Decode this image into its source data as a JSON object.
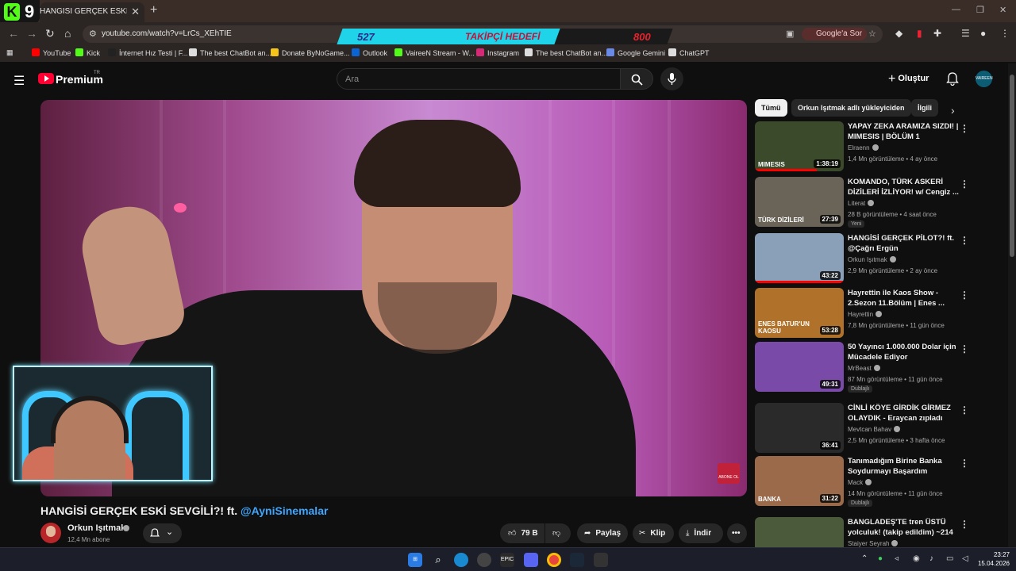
{
  "browser": {
    "tab_title": "HANGİSİ GERÇEK ESKİ SEVGİLİ?! ft.",
    "url": "youtube.com/watch?v=LrCs_XEhTIE",
    "google_sor": "Google'a Sor",
    "bookmarks": [
      "YouTube",
      "Kick",
      "İnternet Hız Testi | F...",
      "The best ChatBot an...",
      "Donate ByNoGame...",
      "Outlook",
      "VaireeN Stream - W...",
      "Instagram",
      "The best ChatBot an...",
      "Google Gemini",
      "ChatGPT"
    ]
  },
  "stream_overlay": {
    "logo_k": "K",
    "logo_9": "9",
    "current": "527",
    "title": "TAKİPÇİ HEDEFİ",
    "goal": "800"
  },
  "youtube": {
    "brand": "Premium",
    "region": "TR",
    "search_placeholder": "Ara",
    "create_label": "Oluştur",
    "avatar_text": "VAIREEN"
  },
  "video": {
    "title_main": "HANGİSİ GERÇEK ESKİ SEVGİLİ?! ft. ",
    "title_link": "@AyniSinemalar",
    "channel": "Orkun Işıtmak",
    "subscribers": "12,4 Mn abone",
    "likes": "79 B",
    "share": "Paylaş",
    "clip": "Klip",
    "download": "İndir",
    "watermark": "ABONE OL"
  },
  "sidebar": {
    "chips": [
      "Tümü",
      "Orkun Işıtmak adlı yükleyiciden",
      "İlgili"
    ],
    "recommendations": [
      {
        "title": "YAPAY ZEKA ARAMIZA SIZDI! | MIMESIS | BÖLÜM 1",
        "channel": "Elraenn",
        "views": "1,4 Mn görüntüleme",
        "age": "4 ay önce",
        "duration": "1:38:19",
        "badge": "",
        "thumb_text": "MIMESIS",
        "progress": 0.7,
        "color": "#3a4a2a"
      },
      {
        "title": "KOMANDO, TÜRK ASKERİ DİZİLERİ İZLİYOR! w/ Cengiz ...",
        "channel": "Literat",
        "views": "28 B görüntüleme",
        "age": "4 saat önce",
        "duration": "27:39",
        "badge": "Yeni",
        "thumb_text": "TÜRK DİZİLERİ",
        "progress": 0,
        "color": "#6a6458"
      },
      {
        "title": "HANGİSİ GERÇEK PİLOT?! ft. @Çağrı Ergün",
        "channel": "Orkun Işıtmak",
        "views": "2,9 Mn görüntüleme",
        "age": "2 ay önce",
        "duration": "43:22",
        "badge": "",
        "thumb_text": "",
        "progress": 1.0,
        "color": "#8aa0b8"
      },
      {
        "title": "Hayrettin ile Kaos Show - 2.Sezon 11.Bölüm | Enes ...",
        "channel": "Hayrettin",
        "views": "7,8 Mn görüntüleme",
        "age": "11 gün önce",
        "duration": "53:28",
        "badge": "",
        "thumb_text": "ENES BATUR'UN KAOSU",
        "progress": 0,
        "color": "#b0722a"
      },
      {
        "title": "50 Yayıncı 1.000.000 Dolar için Mücadele Ediyor",
        "channel": "MrBeast",
        "views": "87 Mn görüntüleme",
        "age": "11 gün önce",
        "duration": "49:31",
        "badge": "Dublajlı",
        "thumb_text": "",
        "progress": 0,
        "color": "#7a4aa8"
      },
      {
        "title": "CİNLİ KÖYE GİRDİK GİRMEZ OLAYDIK - Eraycan zıpladı",
        "channel": "Mevtcan Bahav",
        "views": "2,5 Mn görüntüleme",
        "age": "3 hafta önce",
        "duration": "36:41",
        "badge": "",
        "thumb_text": "",
        "progress": 0,
        "color": "#2a2a2a"
      },
      {
        "title": "Tanımadığım Birine Banka Soydurmayı Başardım",
        "channel": "Mack",
        "views": "14 Mn görüntüleme",
        "age": "11 gün önce",
        "duration": "31:22",
        "badge": "Dublajlı",
        "thumb_text": "BANKA",
        "progress": 0,
        "color": "#9a6a4a"
      },
      {
        "title": "BANGLADEŞ'TE tren ÜSTÜ yolculuk! (takip edildim) ~214",
        "channel": "Staiyer Seyrah",
        "views": "",
        "age": "",
        "duration": "",
        "badge": "",
        "thumb_text": "",
        "progress": 0,
        "color": "#4a5a3a"
      }
    ]
  },
  "taskbar": {
    "time": "23:27",
    "date": "15.04.2026"
  }
}
